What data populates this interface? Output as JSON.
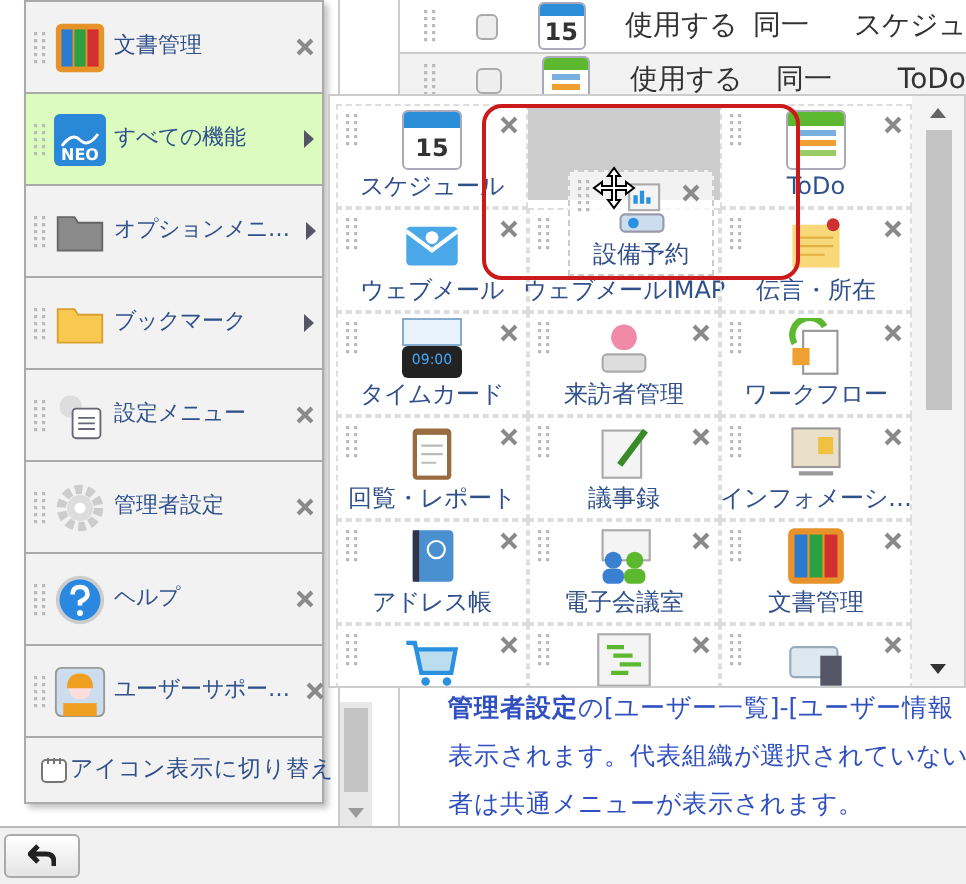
{
  "background_table": {
    "rows": [
      {
        "checked": false,
        "icon_text": "15",
        "cells": [
          "使用する",
          "同一",
          "スケジュ"
        ]
      },
      {
        "checked": false,
        "cells": [
          "使用する",
          "同一",
          "ToDo"
        ]
      }
    ]
  },
  "help_text": [
    "**管理者設定**の[ユーザー一覧]-[ユーザー情報",
    "表示されます。代表組織が選択されていない",
    "者は共通メニューが表示されます。"
  ],
  "menu": {
    "items": [
      {
        "label": "文書管理",
        "selected": false,
        "has_submenu": false
      },
      {
        "label": "すべての機能",
        "icon_text": "NEO",
        "selected": true,
        "has_submenu": true
      },
      {
        "label": "オプションメニ…",
        "selected": false,
        "has_submenu": true
      },
      {
        "label": "ブックマーク",
        "selected": false,
        "has_submenu": true
      },
      {
        "label": "設定メニュー",
        "selected": false,
        "has_submenu": false
      },
      {
        "label": "管理者設定",
        "selected": false,
        "has_submenu": false
      },
      {
        "label": "ヘルプ",
        "selected": false,
        "has_submenu": false
      },
      {
        "label": "ユーザーサポー…",
        "selected": false,
        "has_submenu": false
      }
    ],
    "footer": "アイコン表示に切り替え"
  },
  "submenu": {
    "tiles": [
      {
        "kind": "app",
        "label": "スケジュール",
        "icon_text": "15"
      },
      {
        "kind": "placeholder"
      },
      {
        "kind": "app",
        "label": "ToDo"
      },
      {
        "kind": "app",
        "label": "ウェブメール"
      },
      {
        "kind": "app",
        "label": "ウェブメールIMAP",
        "covered": true
      },
      {
        "kind": "app",
        "label": "伝言・所在"
      },
      {
        "kind": "app",
        "label": "タイムカード",
        "icon_text": "09:00"
      },
      {
        "kind": "app",
        "label": "来訪者管理"
      },
      {
        "kind": "app",
        "label": "ワークフロー"
      },
      {
        "kind": "app",
        "label": "回覧・レポート"
      },
      {
        "kind": "app",
        "label": "議事録"
      },
      {
        "kind": "app",
        "label": "インフォメーシ…"
      },
      {
        "kind": "app",
        "label": "アドレス帳"
      },
      {
        "kind": "app",
        "label": "電子会議室"
      },
      {
        "kind": "app",
        "label": "文書管理"
      },
      {
        "kind": "app"
      },
      {
        "kind": "app"
      },
      {
        "kind": "app"
      }
    ],
    "dragged_tile": {
      "label": "設備予約",
      "highlighted": true
    }
  }
}
